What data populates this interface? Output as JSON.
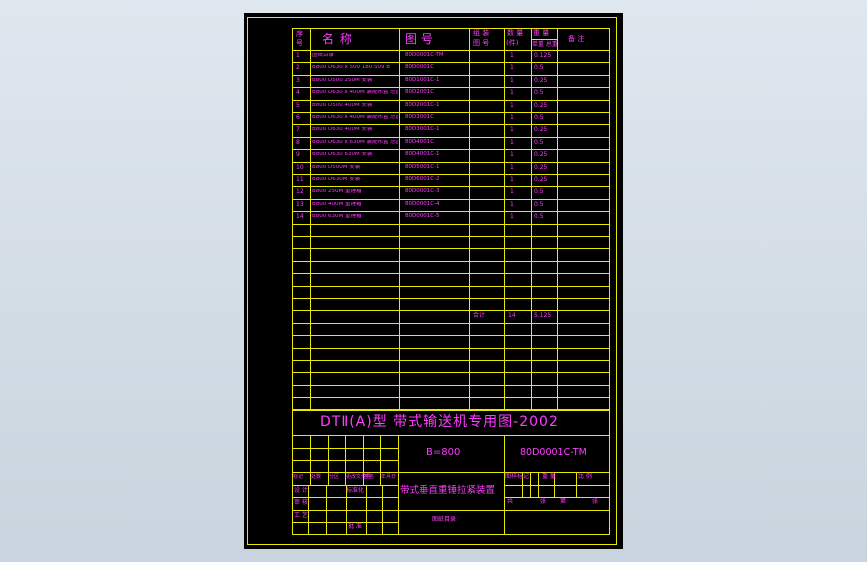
{
  "header": {
    "seq": "序号",
    "name": "名 称",
    "drawing_no": "图 号",
    "group_no": "组装图号",
    "qty": "数量",
    "weight_single": "单重",
    "weight_total": "总重",
    "remark": "备 注"
  },
  "rows": [
    {
      "n": "1",
      "name": "图纸目录",
      "code": "80D0001C-TM",
      "qty": "1",
      "w": "0.125"
    },
    {
      "n": "2",
      "name": "B800 D630 x 500 180.509 B",
      "code": "80D0001C",
      "qty": "1",
      "w": "0.5"
    },
    {
      "n": "3",
      "name": "B800 D500 250M 安装",
      "code": "80D1001C-1",
      "qty": "1",
      "w": "0.25"
    },
    {
      "n": "4",
      "name": "B800 D630 x 400M 装配布置 总图",
      "code": "80D2001C",
      "qty": "1",
      "w": "0.5"
    },
    {
      "n": "5",
      "name": "B800 D500 400M 安装",
      "code": "80D2001C-1",
      "qty": "1",
      "w": "0.25"
    },
    {
      "n": "6",
      "name": "B800 D630 x 400M 装配布置 总图",
      "code": "80D3001C",
      "qty": "1",
      "w": "0.5"
    },
    {
      "n": "7",
      "name": "B800 D630 400M 安装",
      "code": "80D3001C-1",
      "qty": "1",
      "w": "0.25"
    },
    {
      "n": "8",
      "name": "B800 D630 x 630M 装配布置 总图",
      "code": "80D4001C",
      "qty": "1",
      "w": "0.5"
    },
    {
      "n": "9",
      "name": "B800 D630 630M 安装",
      "code": "80D4001C-1",
      "qty": "1",
      "w": "0.25"
    },
    {
      "n": "10",
      "name": "B800 D500M 安装",
      "code": "80D5001C-1",
      "qty": "1",
      "w": "0.25"
    },
    {
      "n": "11",
      "name": "B800 D630M 安装",
      "code": "80D6001C-2",
      "qty": "1",
      "w": "0.25"
    },
    {
      "n": "12",
      "name": "B800 250M 重锤箱",
      "code": "80D0001C-3",
      "qty": "1",
      "w": "0.5"
    },
    {
      "n": "13",
      "name": "B800 400M 重锤箱",
      "code": "80D0001C-4",
      "qty": "1",
      "w": "0.5"
    },
    {
      "n": "14",
      "name": "B800 630M 重锤箱",
      "code": "80D0001C-5",
      "qty": "1",
      "w": "0.5"
    }
  ],
  "totals": {
    "label": "合计",
    "qty": "14",
    "weight": "5.125"
  },
  "title_block": {
    "main_title": "DTⅡ(A)型 带式输送机专用图-2002",
    "spec": "B=800",
    "drawing_number": "80D0001C-TM",
    "description": "带式垂直重锤拉紧装置",
    "catalog_label": "图纸目录",
    "change_headers": [
      "标记",
      "处数",
      "分区",
      "更改文件号",
      "签名",
      "年月日"
    ],
    "role_labels": [
      "设 计",
      "审 核",
      "工 艺"
    ],
    "standardization": "标准化",
    "approve": "批 准",
    "stage_mark": "图样标记",
    "weight_label": "重 量",
    "scale_label": "比 例",
    "sheet_total": "共",
    "sheet_word": "张",
    "sheet_page": "第"
  }
}
